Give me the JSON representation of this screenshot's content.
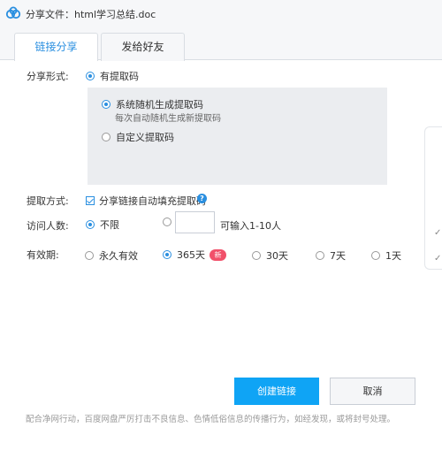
{
  "window": {
    "title": "分享文件：html学习总结.doc",
    "logo_icon": "baidu-netdisk-cloud-logo"
  },
  "tabs": [
    {
      "label": "链接分享",
      "active": true
    },
    {
      "label": "发给好友",
      "active": false
    }
  ],
  "share_form": {
    "label": "分享形式:",
    "option_label": "有提取码",
    "selected": true,
    "sub_options": [
      {
        "label": "系统随机生成提取码",
        "description": "每次自动随机生成新提取码",
        "selected": true
      },
      {
        "label": "自定义提取码",
        "selected": false
      }
    ]
  },
  "extract_method": {
    "label": "提取方式:",
    "checkbox_label": "分享链接自动填充提取码",
    "checked": true,
    "help_icon": "question-circle-icon",
    "help_glyph": "?"
  },
  "visitors": {
    "label": "访问人数:",
    "options": [
      {
        "label": "不限",
        "selected": true
      },
      {
        "label": "可输入1-10人",
        "selected": false
      }
    ],
    "input_value": ""
  },
  "validity": {
    "label": "有效期:",
    "options": [
      {
        "label": "永久有效",
        "selected": false
      },
      {
        "label": "365天",
        "selected": true,
        "badge": "新"
      },
      {
        "label": "30天",
        "selected": false
      },
      {
        "label": "7天",
        "selected": false
      },
      {
        "label": "1天",
        "selected": false
      }
    ]
  },
  "side_panel": {
    "checks": [
      "✓",
      "✓"
    ]
  },
  "buttons": {
    "create": "创建链接",
    "cancel": "取消"
  },
  "footer": "配合净网行动，百度网盘严厉打击不良信息、色情低俗信息的传播行为，如经发现，或将封号处理。",
  "colors": {
    "accent": "#2a8fe0",
    "primary_button": "#0fa4f5",
    "badge": "#f1506a"
  }
}
